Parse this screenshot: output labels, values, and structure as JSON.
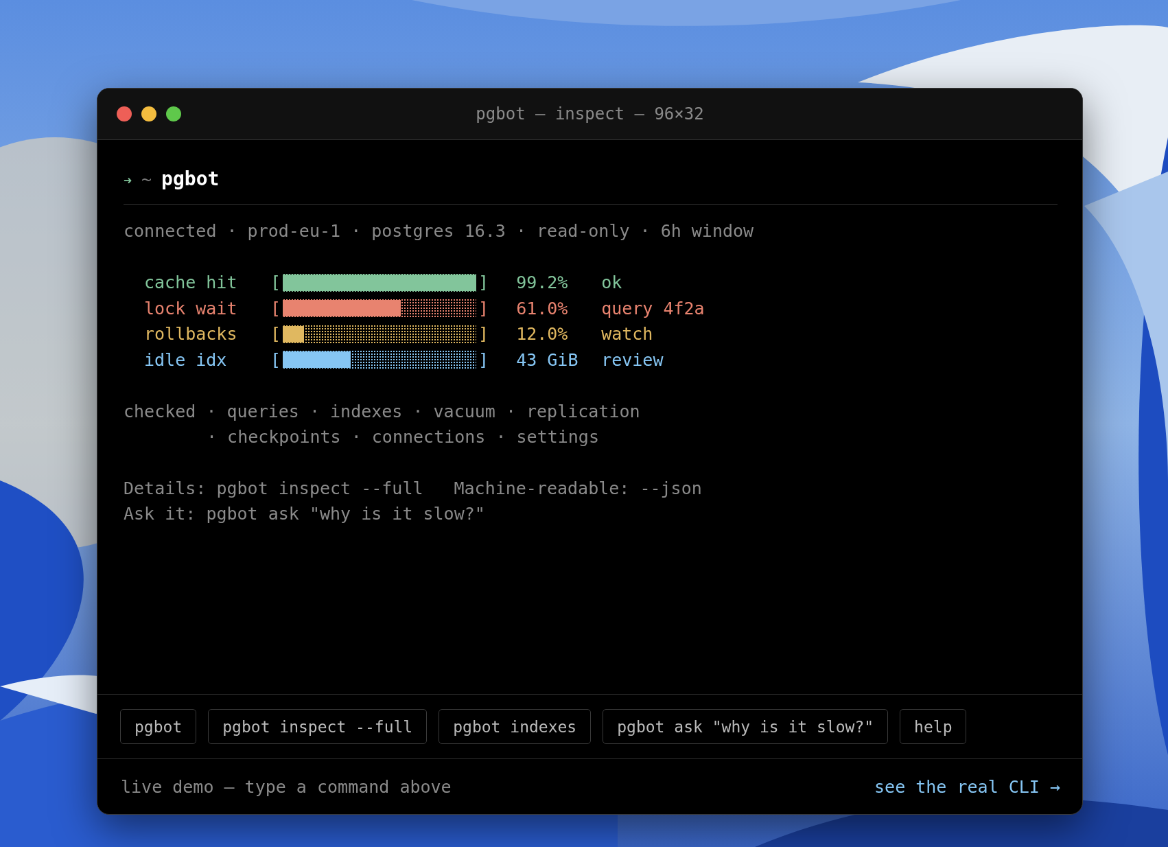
{
  "window": {
    "title": "pgbot — inspect — 96×32"
  },
  "prompt": {
    "arrow": "➜",
    "cwd": "~",
    "command": "pgbot"
  },
  "status_line": "connected · prod-eu-1 · postgres 16.3 · read-only · 6h window",
  "meters": [
    {
      "label": "cache hit",
      "left": "[",
      "right": "]",
      "level": 1.0,
      "reading": "99.2%",
      "status": "ok",
      "color": "#82c59b"
    },
    {
      "label": "lock wait",
      "left": "[",
      "right": "]",
      "level": 0.61,
      "reading": "61.0%",
      "status": "query 4f2a",
      "color": "#e8836f"
    },
    {
      "label": "rollbacks",
      "left": "[",
      "right": "]",
      "level": 0.11,
      "reading": "12.0%",
      "status": "watch",
      "color": "#e0b860"
    },
    {
      "label": "idle idx",
      "left": "[",
      "right": "]",
      "level": 0.35,
      "reading": "43 GiB",
      "status": "review",
      "color": "#86c6f4"
    }
  ],
  "checked_lines": [
    "checked · queries · indexes · vacuum · replication",
    "· checkpoints · connections · settings"
  ],
  "hints": [
    [
      "Details: pgbot inspect --full",
      "Machine-readable: --json"
    ],
    [
      "Ask it: pgbot ask \"why is it slow?\""
    ]
  ],
  "commands": [
    "pgbot",
    "pgbot inspect --full",
    "pgbot indexes",
    "pgbot ask \"why is it slow?\"",
    "help"
  ],
  "footer": {
    "note": "live demo — type a command above",
    "link": "see the real CLI →"
  }
}
